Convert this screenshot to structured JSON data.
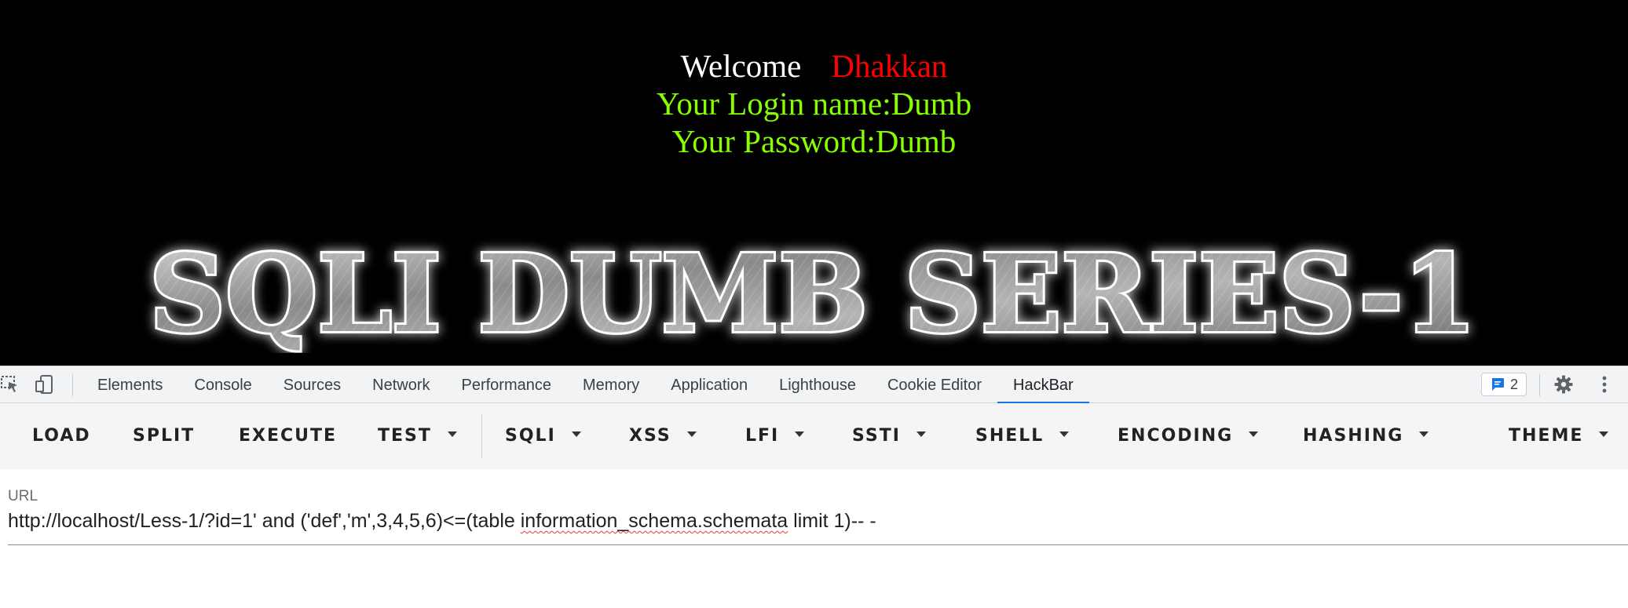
{
  "page": {
    "greeting": {
      "welcome": "Welcome",
      "user": "Dhakkan"
    },
    "login_line": "Your Login name:Dumb",
    "password_line": "Your Password:Dumb",
    "banner_text": "SQLI DUMB SERIES-1"
  },
  "devtools": {
    "tabs": [
      "Elements",
      "Console",
      "Sources",
      "Network",
      "Performance",
      "Memory",
      "Application",
      "Lighthouse",
      "Cookie Editor",
      "HackBar"
    ],
    "active_tab": "HackBar",
    "issues_count": "2"
  },
  "hackbar": {
    "buttons": {
      "load": "LOAD",
      "split": "SPLIT",
      "execute": "EXECUTE",
      "test": "TEST",
      "sqli": "SQLI",
      "xss": "XSS",
      "lfi": "LFI",
      "ssti": "SSTI",
      "shell": "SHELL",
      "encoding": "ENCODING",
      "hashing": "HASHING",
      "theme": "THEME"
    },
    "url_label": "URL",
    "url_before": "http://localhost/Less-1/?id=1' and ('def','m',3,4,5,6)<=(table ",
    "url_spell": "information_schema.schemata",
    "url_after": " limit 1)-- -"
  },
  "colors": {
    "user": "#ff0000",
    "login_text": "#88ff00",
    "tab_accent": "#1a73e8",
    "page_bg": "#000000"
  }
}
